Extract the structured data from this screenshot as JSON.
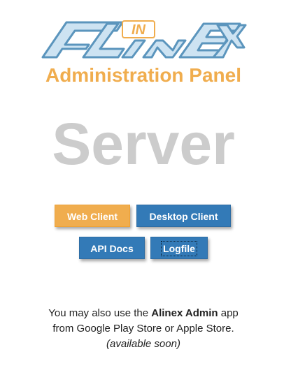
{
  "logo": {
    "text_left": "AL",
    "text_middle": "IN",
    "text_right": "EX",
    "outline_color": "#5b95bd",
    "fill_color": "#cde3f2",
    "accent_color": "#f0ad4e"
  },
  "header": {
    "subtitle": "Administration Panel",
    "title": "Server"
  },
  "buttons": {
    "web_client": "Web Client",
    "desktop_client": "Desktop Client",
    "api_docs": "API Docs",
    "logfile": "Logfile"
  },
  "footer": {
    "line1_prefix": "You may also use the ",
    "app_name": "Alinex Admin",
    "line1_suffix": " app",
    "line2": "from Google Play Store or Apple Store.",
    "line3": "(available soon)"
  },
  "colors": {
    "warning": "#f0ad4e",
    "primary": "#337ab7",
    "title_gray": "#cccccc"
  }
}
